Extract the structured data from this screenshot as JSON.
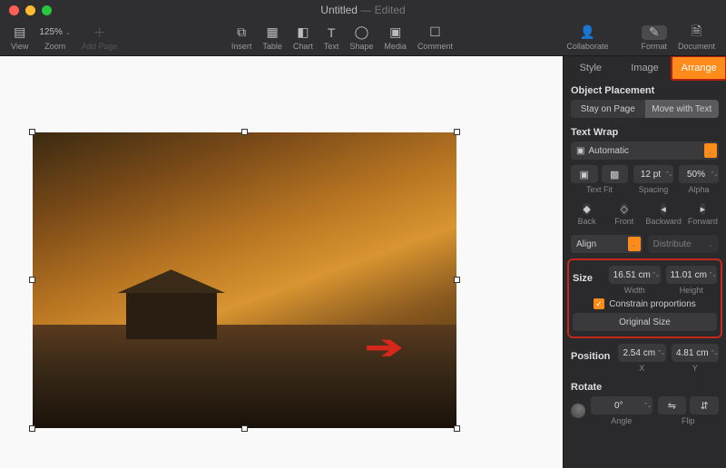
{
  "title": {
    "name": "Untitled",
    "state": "Edited"
  },
  "toolbar": {
    "view": "View",
    "zoom": "Zoom",
    "zoom_value": "125%",
    "add_page": "Add Page",
    "insert": "Insert",
    "table": "Table",
    "chart": "Chart",
    "text": "Text",
    "shape": "Shape",
    "media": "Media",
    "comment": "Comment",
    "collaborate": "Collaborate",
    "format": "Format",
    "document": "Document"
  },
  "inspector": {
    "tabs": {
      "style": "Style",
      "image": "Image",
      "arrange": "Arrange"
    },
    "object_placement": {
      "title": "Object Placement",
      "stay": "Stay on Page",
      "move": "Move with Text"
    },
    "text_wrap": {
      "title": "Text Wrap",
      "mode": "Automatic",
      "text_fit": "Text Fit",
      "spacing_label": "Spacing",
      "spacing_value": "12 pt",
      "alpha_label": "Alpha",
      "alpha_value": "50%"
    },
    "z": {
      "back": "Back",
      "front": "Front",
      "backward": "Backward",
      "forward": "Forward"
    },
    "align": {
      "align": "Align",
      "distribute": "Distribute"
    },
    "size": {
      "title": "Size",
      "width_value": "16.51 cm",
      "width_label": "Width",
      "height_value": "11.01 cm",
      "height_label": "Height",
      "constrain": "Constrain proportions",
      "original": "Original Size"
    },
    "position": {
      "title": "Position",
      "x_value": "2.54 cm",
      "x_label": "X",
      "y_value": "4.81 cm",
      "y_label": "Y"
    },
    "rotate": {
      "title": "Rotate",
      "angle_value": "0°",
      "angle_label": "Angle",
      "flip_label": "Flip"
    }
  }
}
